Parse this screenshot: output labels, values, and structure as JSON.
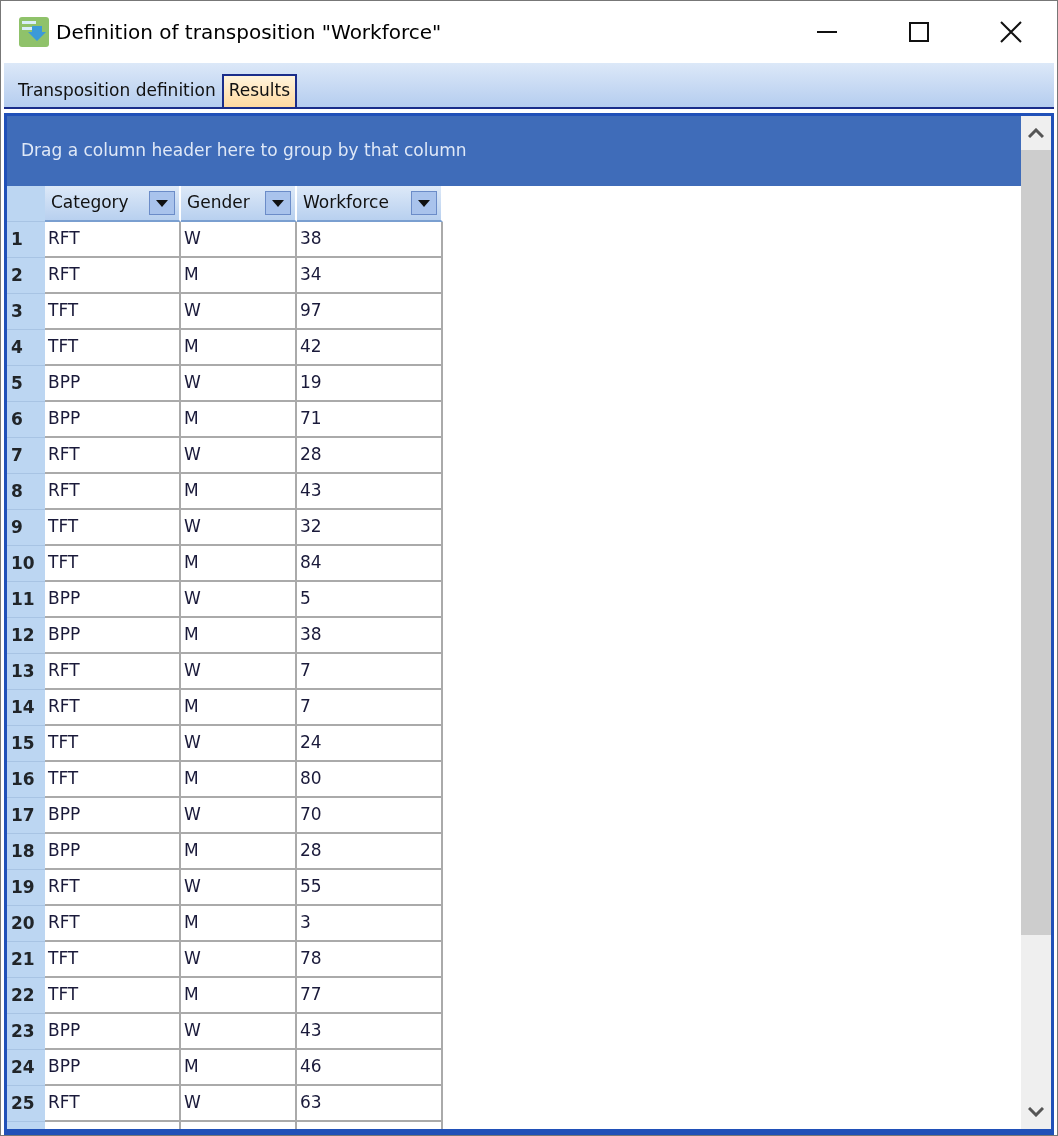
{
  "window": {
    "title": "Definition of transposition \"Workforce\""
  },
  "tabs": [
    {
      "label": "Transposition definition",
      "selected": false
    },
    {
      "label": "Results",
      "selected": true
    }
  ],
  "group_panel": {
    "text": "Drag a column header here to group by that column"
  },
  "table": {
    "columns": [
      "Category",
      "Gender",
      "Workforce"
    ],
    "rows": [
      {
        "number": "1",
        "cells": [
          "RFT",
          "W",
          "38"
        ]
      },
      {
        "number": "2",
        "cells": [
          "RFT",
          "M",
          "34"
        ]
      },
      {
        "number": "3",
        "cells": [
          "TFT",
          "W",
          "97"
        ]
      },
      {
        "number": "4",
        "cells": [
          "TFT",
          "M",
          "42"
        ]
      },
      {
        "number": "5",
        "cells": [
          "BPP",
          "W",
          "19"
        ]
      },
      {
        "number": "6",
        "cells": [
          "BPP",
          "M",
          "71"
        ]
      },
      {
        "number": "7",
        "cells": [
          "RFT",
          "W",
          "28"
        ]
      },
      {
        "number": "8",
        "cells": [
          "RFT",
          "M",
          "43"
        ]
      },
      {
        "number": "9",
        "cells": [
          "TFT",
          "W",
          "32"
        ]
      },
      {
        "number": "10",
        "cells": [
          "TFT",
          "M",
          "84"
        ]
      },
      {
        "number": "11",
        "cells": [
          "BPP",
          "W",
          "5"
        ]
      },
      {
        "number": "12",
        "cells": [
          "BPP",
          "M",
          "38"
        ]
      },
      {
        "number": "13",
        "cells": [
          "RFT",
          "W",
          "7"
        ]
      },
      {
        "number": "14",
        "cells": [
          "RFT",
          "M",
          "7"
        ]
      },
      {
        "number": "15",
        "cells": [
          "TFT",
          "W",
          "24"
        ]
      },
      {
        "number": "16",
        "cells": [
          "TFT",
          "M",
          "80"
        ]
      },
      {
        "number": "17",
        "cells": [
          "BPP",
          "W",
          "70"
        ]
      },
      {
        "number": "18",
        "cells": [
          "BPP",
          "M",
          "28"
        ]
      },
      {
        "number": "19",
        "cells": [
          "RFT",
          "W",
          "55"
        ]
      },
      {
        "number": "20",
        "cells": [
          "RFT",
          "M",
          "3"
        ]
      },
      {
        "number": "21",
        "cells": [
          "TFT",
          "W",
          "78"
        ]
      },
      {
        "number": "22",
        "cells": [
          "TFT",
          "M",
          "77"
        ]
      },
      {
        "number": "23",
        "cells": [
          "BPP",
          "W",
          "43"
        ]
      },
      {
        "number": "24",
        "cells": [
          "BPP",
          "M",
          "46"
        ]
      },
      {
        "number": "25",
        "cells": [
          "RFT",
          "W",
          "63"
        ]
      }
    ]
  }
}
